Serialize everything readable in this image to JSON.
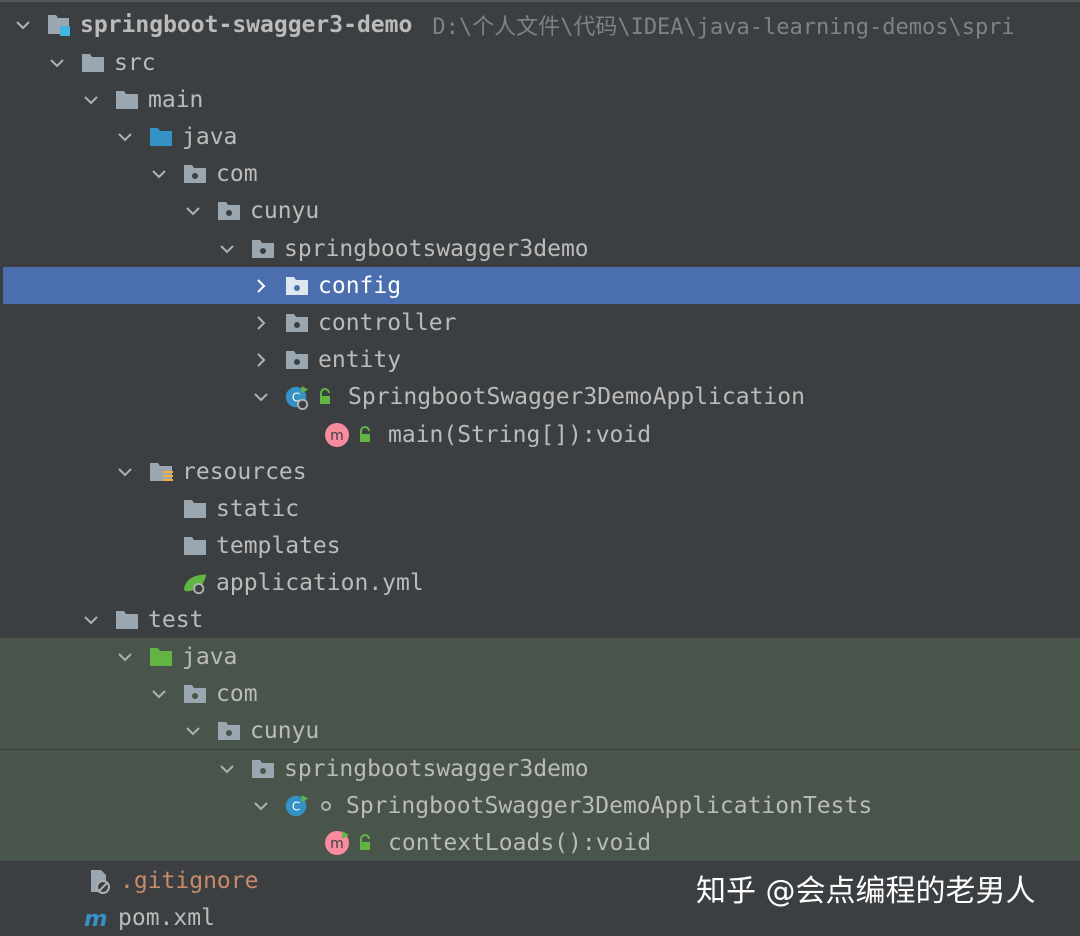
{
  "colors": {
    "background": "#3c3f41",
    "selection": "#4b6eaf",
    "test_background": "#49544a",
    "text": "#bbbbbb",
    "path_text": "#7f8284",
    "ignored_text": "#c88a6a"
  },
  "tree": {
    "nodes": [
      {
        "label": "springboot-swagger3-demo",
        "path": "D:\\个人文件\\代码\\IDEA\\java-learning-demos\\spri",
        "icon": "module-folder-icon",
        "arrow": "expanded"
      },
      {
        "label": "src",
        "icon": "folder-icon",
        "arrow": "expanded"
      },
      {
        "label": "main",
        "icon": "folder-icon",
        "arrow": "expanded"
      },
      {
        "label": "java",
        "icon": "source-root-folder-icon",
        "arrow": "expanded"
      },
      {
        "label": "com",
        "icon": "package-icon",
        "arrow": "expanded"
      },
      {
        "label": "cunyu",
        "icon": "package-icon",
        "arrow": "expanded"
      },
      {
        "label": "springbootswagger3demo",
        "icon": "package-icon",
        "arrow": "expanded"
      },
      {
        "label": "config",
        "icon": "package-icon",
        "arrow": "collapsed",
        "selected": true
      },
      {
        "label": "controller",
        "icon": "package-icon",
        "arrow": "collapsed"
      },
      {
        "label": "entity",
        "icon": "package-icon",
        "arrow": "collapsed"
      },
      {
        "label": "SpringbootSwagger3DemoApplication",
        "icon": "spring-boot-class-icon",
        "arrow": "expanded"
      },
      {
        "label": "main(String[]):void",
        "icon": "method-icon"
      },
      {
        "label": "resources",
        "icon": "resources-folder-icon",
        "arrow": "expanded"
      },
      {
        "label": "static",
        "icon": "folder-icon"
      },
      {
        "label": "templates",
        "icon": "folder-icon"
      },
      {
        "label": "application.yml",
        "icon": "spring-config-icon"
      },
      {
        "label": "test",
        "icon": "folder-icon",
        "arrow": "expanded"
      },
      {
        "label": "java",
        "icon": "test-root-folder-icon",
        "arrow": "expanded"
      },
      {
        "label": "com",
        "icon": "package-icon",
        "arrow": "expanded"
      },
      {
        "label": "cunyu",
        "icon": "package-icon",
        "arrow": "expanded"
      },
      {
        "label": "springbootswagger3demo",
        "icon": "package-icon",
        "arrow": "expanded"
      },
      {
        "label": "SpringbootSwagger3DemoApplicationTests",
        "icon": "class-icon",
        "arrow": "expanded"
      },
      {
        "label": "contextLoads():void",
        "icon": "method-icon"
      },
      {
        "label": ".gitignore",
        "icon": "ignore-file-icon"
      },
      {
        "label": "pom.xml",
        "icon": "maven-icon"
      }
    ]
  },
  "watermark": {
    "text": "知乎 @会点编程的老男人"
  }
}
